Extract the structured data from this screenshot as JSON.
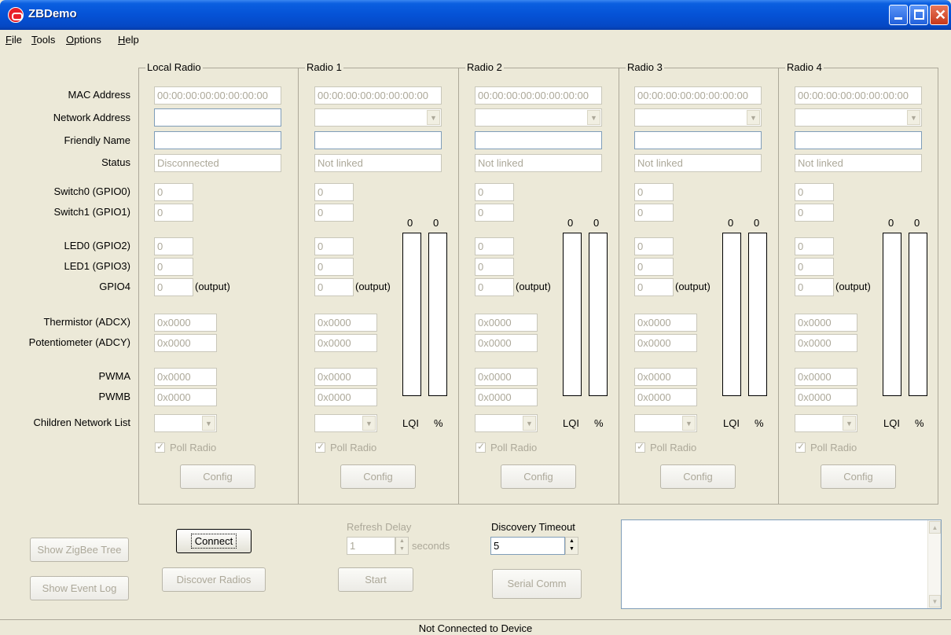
{
  "window": {
    "title": "ZBDemo"
  },
  "menu": [
    {
      "label": "File",
      "key": "F",
      "rest": "ile"
    },
    {
      "label": "Tools",
      "key": "T",
      "rest": "ools"
    },
    {
      "label": "Options",
      "key": "O",
      "rest": "ptions"
    },
    {
      "label": "Help",
      "key": "H",
      "rest": "elp"
    }
  ],
  "labels": {
    "mac": "MAC Address",
    "network": "Network Address",
    "friendly": "Friendly Name",
    "status": "Status",
    "switch0": "Switch0 (GPIO0)",
    "switch1": "Switch1 (GPIO1)",
    "led0": "LED0 (GPIO2)",
    "led1": "LED1 (GPIO3)",
    "gpio4": "GPIO4",
    "thermistor": "Thermistor (ADCX)",
    "potentiometer": "Potentiometer (ADCY)",
    "pwma": "PWMA",
    "pwmb": "PWMB",
    "children": "Children Network List"
  },
  "radios": [
    {
      "title": "Local Radio",
      "mac": "00:00:00:00:00:00:00:00",
      "status": "Disconnected",
      "switch0": "0",
      "switch1": "0",
      "led0": "0",
      "led1": "0",
      "gpio4": "0",
      "output": "(output)",
      "adcx": "0x0000",
      "adcy": "0x0000",
      "pwma": "0x0000",
      "pwmb": "0x0000",
      "poll": "Poll Radio",
      "config": "Config"
    },
    {
      "title": "Radio 1",
      "mac": "00:00:00:00:00:00:00:00",
      "status": "Not linked",
      "switch0": "0",
      "switch1": "0",
      "led0": "0",
      "led1": "0",
      "gpio4": "0",
      "output": "(output)",
      "adcx": "0x0000",
      "adcy": "0x0000",
      "pwma": "0x0000",
      "pwmb": "0x0000",
      "poll": "Poll Radio",
      "config": "Config",
      "lqi_value": "0",
      "pct_value": "0",
      "lqi_label": "LQI",
      "pct_label": "%"
    },
    {
      "title": "Radio 2",
      "mac": "00:00:00:00:00:00:00:00",
      "status": "Not linked",
      "switch0": "0",
      "switch1": "0",
      "led0": "0",
      "led1": "0",
      "gpio4": "0",
      "output": "(output)",
      "adcx": "0x0000",
      "adcy": "0x0000",
      "pwma": "0x0000",
      "pwmb": "0x0000",
      "poll": "Poll Radio",
      "config": "Config",
      "lqi_value": "0",
      "pct_value": "0",
      "lqi_label": "LQI",
      "pct_label": "%"
    },
    {
      "title": "Radio 3",
      "mac": "00:00:00:00:00:00:00:00",
      "status": "Not linked",
      "switch0": "0",
      "switch1": "0",
      "led0": "0",
      "led1": "0",
      "gpio4": "0",
      "output": "(output)",
      "adcx": "0x0000",
      "adcy": "0x0000",
      "pwma": "0x0000",
      "pwmb": "0x0000",
      "poll": "Poll Radio",
      "config": "Config",
      "lqi_value": "0",
      "pct_value": "0",
      "lqi_label": "LQI",
      "pct_label": "%"
    },
    {
      "title": "Radio 4",
      "mac": "00:00:00:00:00:00:00:00",
      "status": "Not linked",
      "switch0": "0",
      "switch1": "0",
      "led0": "0",
      "led1": "0",
      "gpio4": "0",
      "output": "(output)",
      "adcx": "0x0000",
      "adcy": "0x0000",
      "pwma": "0x0000",
      "pwmb": "0x0000",
      "poll": "Poll Radio",
      "config": "Config",
      "lqi_value": "0",
      "pct_value": "0",
      "lqi_label": "LQI",
      "pct_label": "%"
    }
  ],
  "bottom": {
    "show_tree": "Show ZigBee Tree",
    "show_log": "Show  Event Log",
    "connect": "Connect",
    "discover": "Discover Radios",
    "refresh_label": "Refresh Delay",
    "refresh_value": "1",
    "seconds": "seconds",
    "start": "Start",
    "discovery_label": "Discovery Timeout",
    "discovery_value": "5",
    "serial": "Serial Comm"
  },
  "status_bar": "Not Connected to Device"
}
